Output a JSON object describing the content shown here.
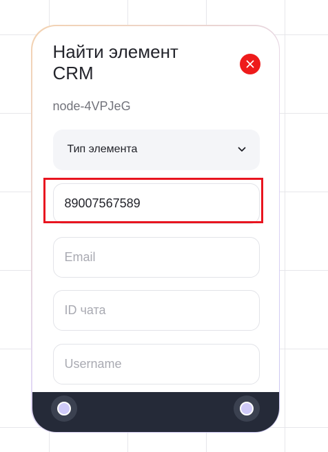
{
  "node": {
    "title": "Найти элемент CRM",
    "id": "node-4VPJeG",
    "close_icon": "close-icon",
    "element_type_select": {
      "label": "Тип элемента",
      "icon": "chevron-down-icon"
    },
    "fields": {
      "phone": {
        "value": "89007567589"
      },
      "email": {
        "placeholder": "Email"
      },
      "chat_id": {
        "placeholder": "ID чата"
      },
      "username": {
        "placeholder": "Username"
      }
    }
  },
  "colors": {
    "close_button": "#ee1b1b",
    "highlight_box": "#e8141f",
    "footer": "#252a38",
    "handle": "#cfcaf8"
  }
}
